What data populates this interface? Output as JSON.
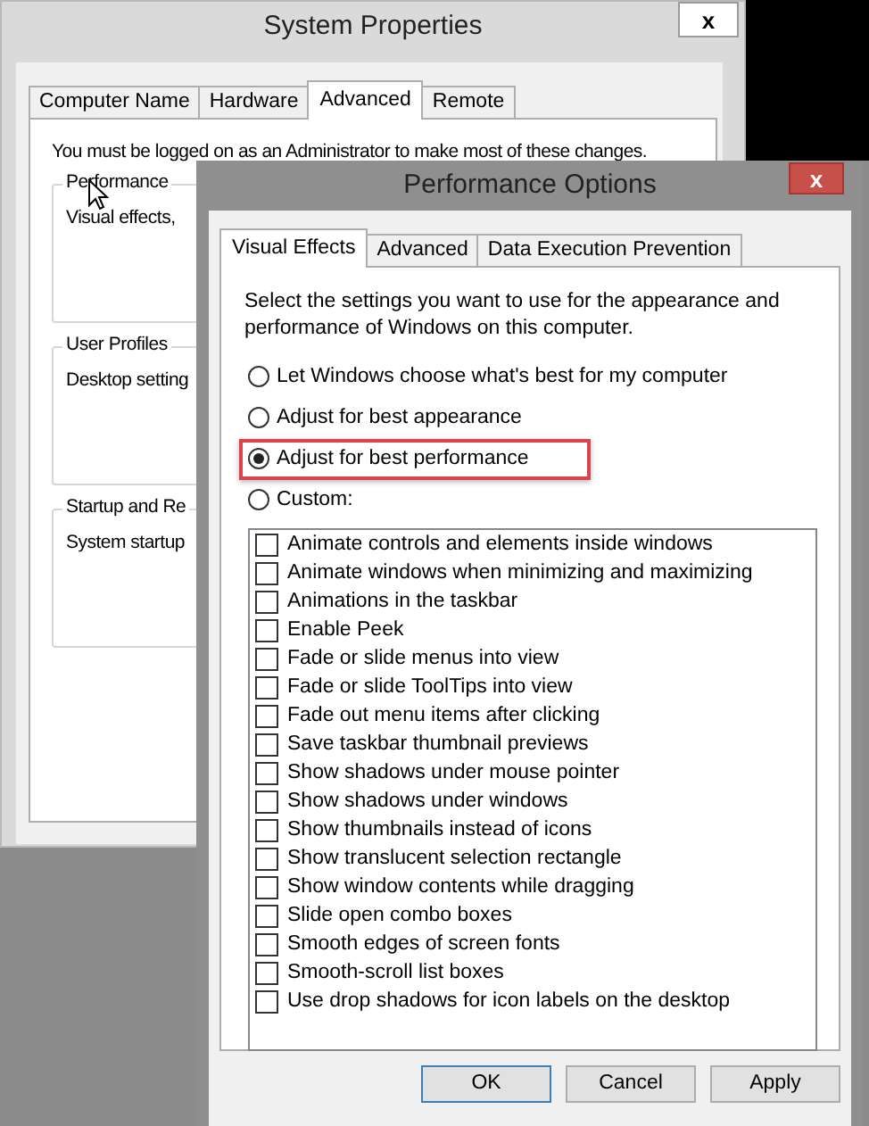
{
  "system_properties": {
    "title": "System Properties",
    "close": "x",
    "tabs": [
      {
        "label": "Computer Name",
        "selected": false
      },
      {
        "label": "Hardware",
        "selected": false
      },
      {
        "label": "Advanced",
        "selected": true
      },
      {
        "label": "Remote",
        "selected": false
      }
    ],
    "notice": "You must be logged on as an Administrator to make most of these changes.",
    "groups": [
      {
        "label": "Performance",
        "text": "Visual effects,"
      },
      {
        "label": "User Profiles",
        "text": "Desktop setting"
      },
      {
        "label": "Startup and Re",
        "text": "System startup"
      }
    ]
  },
  "performance_options": {
    "title": "Performance Options",
    "close": "x",
    "tabs": [
      {
        "label": "Visual Effects",
        "selected": true
      },
      {
        "label": "Advanced",
        "selected": false
      },
      {
        "label": "Data Execution Prevention",
        "selected": false
      }
    ],
    "description": "Select the settings you want to use for the appearance and performance of Windows on this computer.",
    "options": [
      {
        "label": "Let Windows choose what's best for my computer",
        "selected": false,
        "highlighted": false
      },
      {
        "label": "Adjust for best appearance",
        "selected": false,
        "highlighted": false
      },
      {
        "label": "Adjust for best performance",
        "selected": true,
        "highlighted": true
      },
      {
        "label": "Custom:",
        "selected": false,
        "highlighted": false
      }
    ],
    "effects": [
      {
        "label": "Animate controls and elements inside windows",
        "checked": false
      },
      {
        "label": "Animate windows when minimizing and maximizing",
        "checked": false
      },
      {
        "label": "Animations in the taskbar",
        "checked": false
      },
      {
        "label": "Enable Peek",
        "checked": false
      },
      {
        "label": "Fade or slide menus into view",
        "checked": false
      },
      {
        "label": "Fade or slide ToolTips into view",
        "checked": false
      },
      {
        "label": "Fade out menu items after clicking",
        "checked": false
      },
      {
        "label": "Save taskbar thumbnail previews",
        "checked": false
      },
      {
        "label": "Show shadows under mouse pointer",
        "checked": false
      },
      {
        "label": "Show shadows under windows",
        "checked": false
      },
      {
        "label": "Show thumbnails instead of icons",
        "checked": false
      },
      {
        "label": "Show translucent selection rectangle",
        "checked": false
      },
      {
        "label": "Show window contents while dragging",
        "checked": false
      },
      {
        "label": "Slide open combo boxes",
        "checked": false
      },
      {
        "label": "Smooth edges of screen fonts",
        "checked": false
      },
      {
        "label": "Smooth-scroll list boxes",
        "checked": false
      },
      {
        "label": "Use drop shadows for icon labels on the desktop",
        "checked": false
      }
    ],
    "buttons": [
      {
        "label": "OK",
        "default": true
      },
      {
        "label": "Cancel",
        "default": false
      },
      {
        "label": "Apply",
        "default": false
      }
    ]
  }
}
